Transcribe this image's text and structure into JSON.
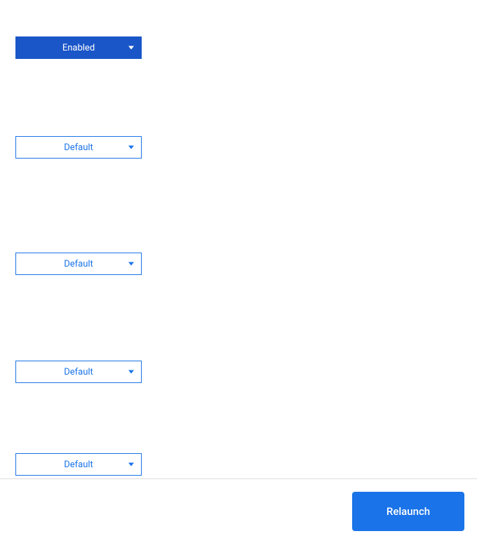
{
  "dropdowns": [
    {
      "label": "Enabled",
      "style": "filled"
    },
    {
      "label": "Default",
      "style": "outlined"
    },
    {
      "label": "Default",
      "style": "outlined"
    },
    {
      "label": "Default",
      "style": "outlined"
    },
    {
      "label": "Default",
      "style": "outlined"
    }
  ],
  "footer": {
    "relaunch_label": "Relaunch"
  },
  "colors": {
    "primary": "#1a73e8",
    "primary_dark": "#1a56c8",
    "border": "#dcdcdc"
  }
}
